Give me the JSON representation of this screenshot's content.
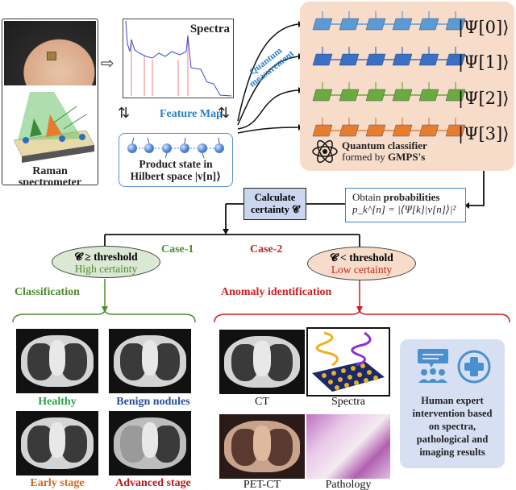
{
  "raman": {
    "label_line1": "Raman",
    "label_line2": "spectrometer"
  },
  "spectra": {
    "title": "Spectra"
  },
  "feature_map": {
    "label": "Feature Map"
  },
  "product_state": {
    "line1": "Product state in",
    "line2": "Hilbert space |v[n]⟩"
  },
  "quantum_measurement": {
    "line1": "Quantum",
    "line2": "measurement"
  },
  "classifier": {
    "states": [
      {
        "label": "|Ψ[0]⟩",
        "color": "#5b9bd5"
      },
      {
        "label": "|Ψ[1]⟩",
        "color": "#3a6fc4"
      },
      {
        "label": "|Ψ[2]⟩",
        "color": "#6aaa3f"
      },
      {
        "label": "|Ψ[3]⟩",
        "color": "#e87c2e"
      }
    ],
    "caption_bold": "Quantum classifier",
    "caption_rest_prefix": "formed by ",
    "caption_rest_bold": "GMPS's",
    "panel_color": "#f7dcc9"
  },
  "calculate": {
    "line1": "Calculate",
    "line2": "certainty 𝓒"
  },
  "probabilities": {
    "line1_prefix": "Obtain ",
    "line1_bold": "probabilities",
    "formula": "p_k^[n] = |⟨Ψ[k]|v[n]⟩|²"
  },
  "cases": {
    "case1": "Case-1",
    "case2": "Case-2"
  },
  "high": {
    "condition": "𝓒 ≥ threshold",
    "label": "High certainty",
    "color": "#4d8b2f"
  },
  "low": {
    "condition": "𝓒 < threshold",
    "label": "Low certainty",
    "color": "#cc1f1f"
  },
  "classification": {
    "title": "Classification",
    "images": [
      {
        "label": "Healthy",
        "color": "#2aa24a"
      },
      {
        "label": "Benign nodules",
        "color": "#2a4fa0"
      },
      {
        "label": "Early stage",
        "color": "#d4691c"
      },
      {
        "label": "Advanced stage",
        "color": "#c01818"
      }
    ]
  },
  "anomaly": {
    "title": "Anomaly identification",
    "images": [
      {
        "label": "CT"
      },
      {
        "label": "Spectra"
      },
      {
        "label": "PET-CT"
      },
      {
        "label": "Pathology"
      }
    ],
    "expert_text": [
      "Human expert",
      "intervention based",
      "on spectra,",
      "pathological and",
      "imaging results"
    ]
  }
}
